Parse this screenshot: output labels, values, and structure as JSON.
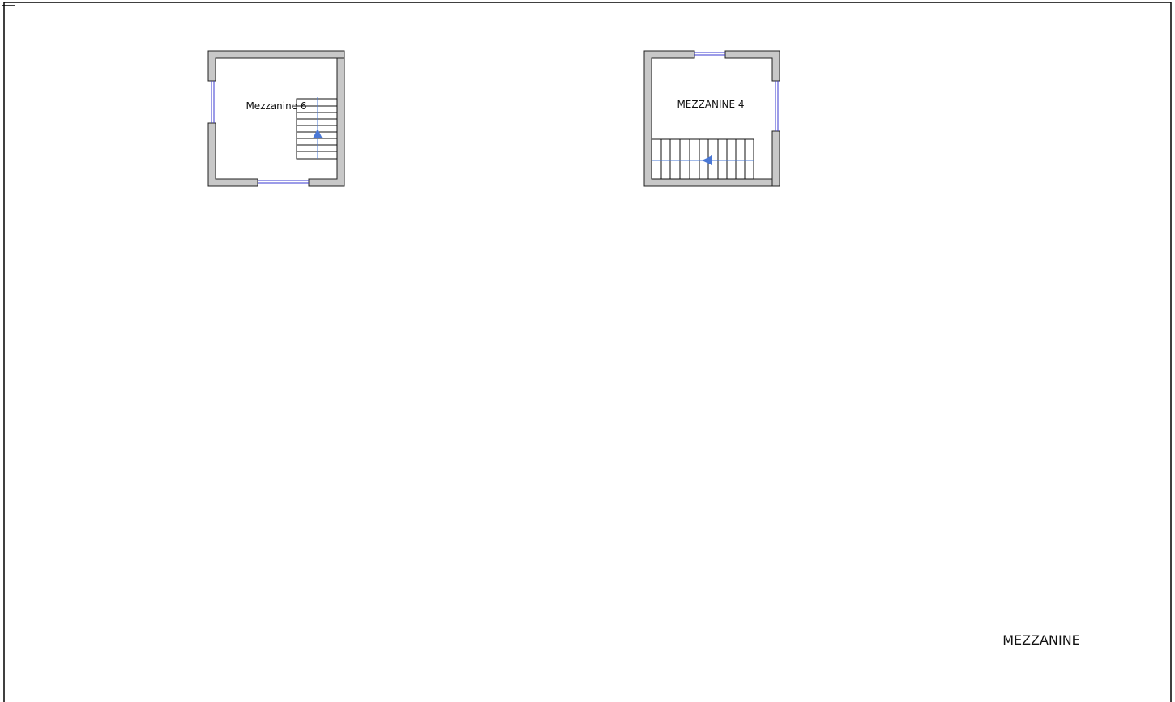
{
  "colors": {
    "wall_fill": "#c8c8c8",
    "wall_stroke": "#202020",
    "window": "#3a3ad0",
    "stair_line": "#111111",
    "arrow": "#4a78d6",
    "border": "#000000"
  },
  "rooms": [
    {
      "id": "mezzanine-6",
      "label": "Mezzanine 6",
      "stair_direction": "up",
      "stair_treads": 10
    },
    {
      "id": "mezzanine-4",
      "label": "MEZZANINE 4",
      "stair_direction": "left",
      "stair_treads": 10
    }
  ],
  "sheet": {
    "label": "MEZZANINE"
  }
}
